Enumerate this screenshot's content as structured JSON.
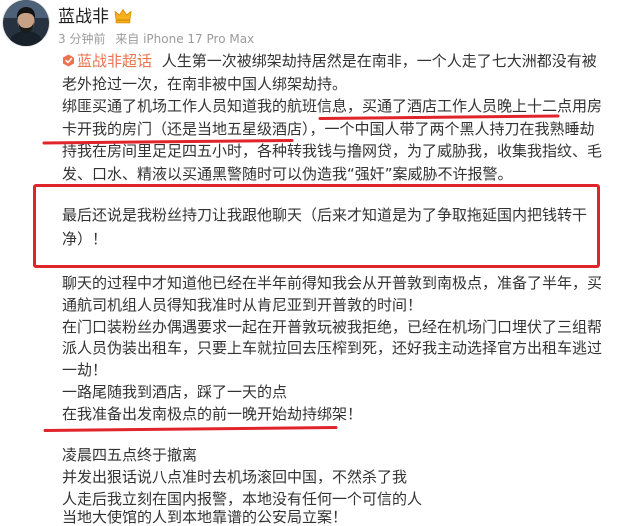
{
  "colors": {
    "text": "#333333",
    "meta": "#9b9b9b",
    "topic_link": "#eb7350",
    "annotation": "#e0242a",
    "badge": "#f5b21e"
  },
  "post": {
    "author": {
      "name": "蓝战非",
      "badge_icon": "vip-crown-icon"
    },
    "meta": {
      "time": "3 分钟前",
      "source": "来自 iPhone 17 Pro Max"
    },
    "topic": {
      "icon": "super-topic-icon",
      "label": "蓝战非超话"
    },
    "body": [
      {
        "boxed": false,
        "lines": [
          "人生第一次被绑架劫持居然是在南非，一个人走了七大洲都没有被",
          "老外抢过一次，在南非被中国人绑架劫持。",
          "绑匪买通了机场工作人员知道我的航班信息，买通了酒店工作人员晚上十二点用房",
          "卡开我的房门（还是当地五星级酒店），一个中国人带了两个黑人持刀在我熟睡劫",
          "持我在房间里足足四五小时，各种转我钱与撸网贷，为了威胁我，收集我指纹、毛",
          "发、口水、精液以买通黑警随时可以伪造我“强奸”案威胁不许报警。"
        ]
      },
      {
        "boxed": true,
        "lines": [
          "最后还说是我粉丝持刀让我跟他聊天（后来才知道是为了争取拖延国内把钱转干",
          "净）！"
        ]
      },
      {
        "boxed": false,
        "lines": [
          "聊天的过程中才知道他已经在半年前得知我会从开普敦到南极点，准备了半年，买",
          "通航司机组人员得知我准时从肯尼亚到开普敦的时间！",
          "在门口装粉丝办偶遇要求一起在开普敦玩被我拒绝，已经在机场门口埋伏了三组帮",
          "派人员伪装出租车，只要上车就拉回去压榨到死，还好我主动选择官方出租车逃过",
          "一劫！",
          "一路尾随我到酒店，踩了一天的点",
          "在我准备出发南极点的前一晚开始劫持绑架！"
        ]
      },
      {
        "boxed": false,
        "lines": [
          "凌晨四五点终于撤离",
          "并发出狠话说八点准时去机场滚回中国，不然杀了我",
          "人走后我立刻在国内报警，本地没有任何一个可信的人",
          "当地大使馆的人到本地靠谱的公安局立案！"
        ]
      }
    ]
  }
}
